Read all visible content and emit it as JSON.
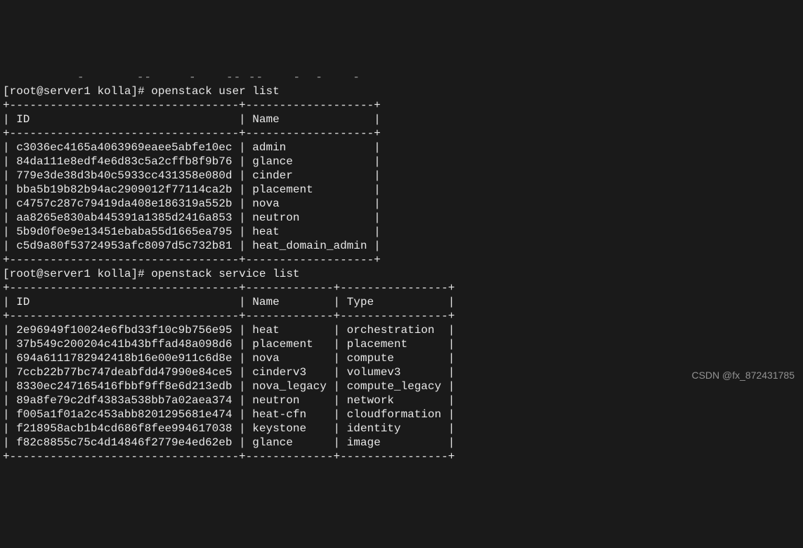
{
  "top_clip": "          -       --     -    -- --    -  -    -",
  "prompt1": {
    "user": "root",
    "host": "server1",
    "cwd": "kolla",
    "command": "openstack user list"
  },
  "user_table": {
    "headers": {
      "id": "ID",
      "name": "Name"
    },
    "rows": [
      {
        "id": "c3036ec4165a4063969eaee5abfe10ec",
        "name": "admin"
      },
      {
        "id": "84da111e8edf4e6d83c5a2cffb8f9b76",
        "name": "glance"
      },
      {
        "id": "779e3de38d3b40c5933cc431358e080d",
        "name": "cinder"
      },
      {
        "id": "bba5b19b82b94ac2909012f77114ca2b",
        "name": "placement"
      },
      {
        "id": "c4757c287c79419da408e186319a552b",
        "name": "nova"
      },
      {
        "id": "aa8265e830ab445391a1385d2416a853",
        "name": "neutron"
      },
      {
        "id": "5b9d0f0e9e13451ebaba55d1665ea795",
        "name": "heat"
      },
      {
        "id": "c5d9a80f53724953afc8097d5c732b81",
        "name": "heat_domain_admin"
      }
    ]
  },
  "prompt2": {
    "user": "root",
    "host": "server1",
    "cwd": "kolla",
    "command": "openstack service list"
  },
  "service_table": {
    "headers": {
      "id": "ID",
      "name": "Name",
      "type": "Type"
    },
    "rows": [
      {
        "id": "2e96949f10024e6fbd33f10c9b756e95",
        "name": "heat",
        "type": "orchestration"
      },
      {
        "id": "37b549c200204c41b43bffad48a098d6",
        "name": "placement",
        "type": "placement"
      },
      {
        "id": "694a6111782942418b16e00e911c6d8e",
        "name": "nova",
        "type": "compute"
      },
      {
        "id": "7ccb22b77bc747deabfdd47990e84ce5",
        "name": "cinderv3",
        "type": "volumev3"
      },
      {
        "id": "8330ec247165416fbbf9ff8e6d213edb",
        "name": "nova_legacy",
        "type": "compute_legacy"
      },
      {
        "id": "89a8fe79c2df4383a538bb7a02aea374",
        "name": "neutron",
        "type": "network"
      },
      {
        "id": "f005a1f01a2c453abb8201295681e474",
        "name": "heat-cfn",
        "type": "cloudformation"
      },
      {
        "id": "f218958acb1b4cd686f8fee994617038",
        "name": "keystone",
        "type": "identity"
      },
      {
        "id": "f82c8855c75c4d14846f2779e4ed62eb",
        "name": "glance",
        "type": "image"
      }
    ]
  },
  "watermark": "CSDN @fx_872431785"
}
